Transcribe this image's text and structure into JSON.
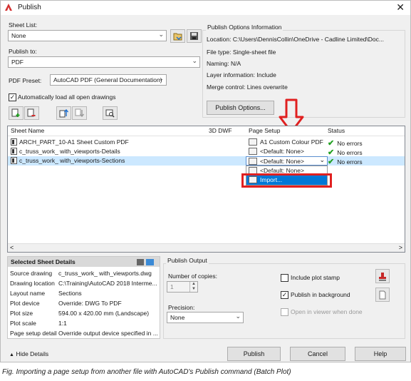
{
  "window": {
    "title": "Publish",
    "close_glyph": "✕"
  },
  "sheet_list": {
    "label": "Sheet List:",
    "value": "None"
  },
  "publish_to": {
    "label": "Publish to:",
    "value": "PDF"
  },
  "pdf_preset": {
    "label": "PDF Preset:",
    "value": "AutoCAD PDF (General Documentation)"
  },
  "auto_load": {
    "label": "Automatically load all open drawings",
    "checked": true
  },
  "publish_options": {
    "heading": "Publish Options Information",
    "location": "Location: C:\\Users\\DennisCollin\\OneDrive - Cadline Limited\\Doc...",
    "file_type": "File type: Single-sheet file",
    "naming": "Naming: N/A",
    "layer_info": "Layer information: Include",
    "merge": "Merge control: Lines overwrite",
    "button": "Publish Options..."
  },
  "table": {
    "columns": [
      "Sheet Name",
      "3D DWF",
      "Page Setup",
      "Status"
    ],
    "rows": [
      {
        "name": "ARCH_PART_10-A1 Sheet Custom PDF",
        "setup": "A1 Custom Colour PDF",
        "status": "No errors"
      },
      {
        "name": "c_truss_work_ with_viewports-Details",
        "setup": "<Default: None>",
        "status": "No errors"
      },
      {
        "name": "c_truss_work_ with_viewports-Sections",
        "setup": "<Default: None>",
        "status": "No errors"
      }
    ],
    "dropdown_options": [
      "<Default: None>",
      "Import..."
    ]
  },
  "details": {
    "title": "Selected Sheet Details",
    "rows": [
      {
        "k": "Source drawing",
        "v": "c_truss_work_ with_viewports.dwg"
      },
      {
        "k": "Drawing location",
        "v": "C:\\Training\\AutoCAD 2018 Interme..."
      },
      {
        "k": "Layout name",
        "v": "Sections"
      },
      {
        "k": "Plot device",
        "v": "Override: DWG To PDF"
      },
      {
        "k": "Plot size",
        "v": "594.00 x 420.00 mm (Landscape)"
      },
      {
        "k": "Plot scale",
        "v": "1:1"
      },
      {
        "k": "Page setup detail",
        "v": "Override output device specified in ..."
      }
    ]
  },
  "publish_output": {
    "heading": "Publish Output",
    "copies_label": "Number of copies:",
    "copies_value": "1",
    "precision_label": "Precision:",
    "precision_value": "None",
    "include_stamp": "Include plot stamp",
    "publish_bg": "Publish in background",
    "open_viewer": "Open in viewer when done"
  },
  "footer": {
    "hide_details": "Hide Details",
    "publish": "Publish",
    "cancel": "Cancel",
    "help": "Help"
  },
  "caption": "Fig. Importing a page setup from another file with AutoCAD's Publish command (Batch Plot)",
  "colors": {
    "selection": "#cce8ff",
    "highlight": "#0078d7",
    "annotation_red": "#e02020"
  }
}
